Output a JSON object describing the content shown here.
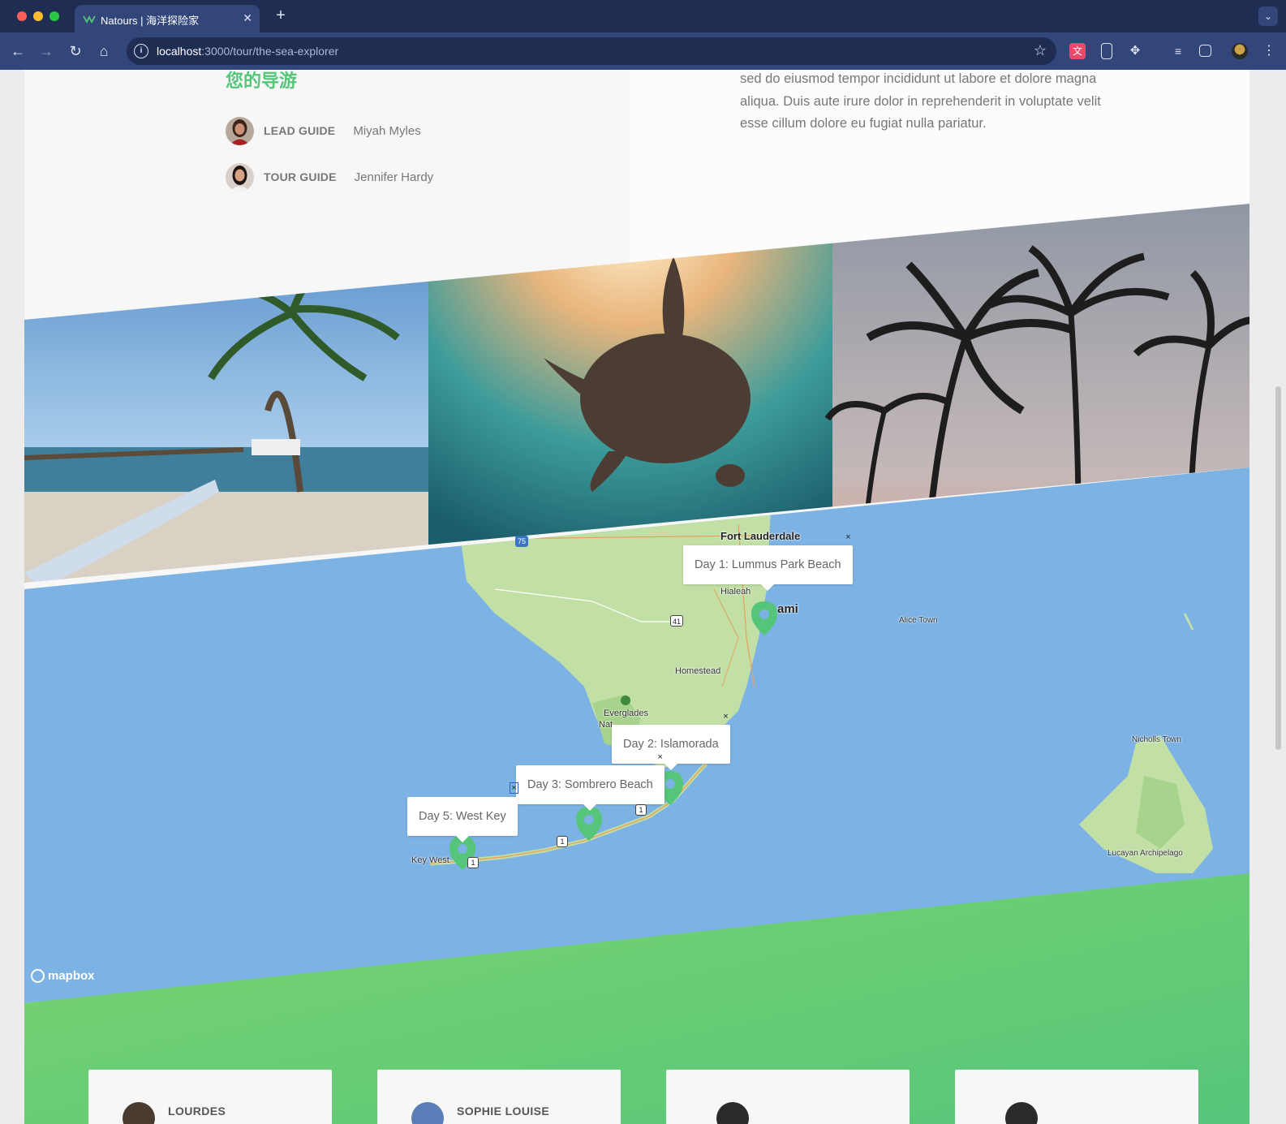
{
  "browser": {
    "tab_title": "Natours | 海洋探险家",
    "url_host": "localhost",
    "url_path": ":3000/tour/the-sea-explorer"
  },
  "guides": {
    "heading": "您的导游",
    "items": [
      {
        "role": "LEAD GUIDE",
        "name": "Miyah Myles"
      },
      {
        "role": "TOUR GUIDE",
        "name": "Jennifer Hardy"
      }
    ]
  },
  "description": {
    "text": "sed do eiusmod tempor incididunt ut labore et dolore magna aliqua. Duis aute irure dolor in reprehenderit in voluptate velit esse cillum dolore eu fugiat nulla pariatur."
  },
  "map": {
    "popups": [
      {
        "label": "Day 1: Lummus Park Beach"
      },
      {
        "label": "Day 2: Islamorada"
      },
      {
        "label": "Day 3: Sombrero Beach"
      },
      {
        "label": "Day 5: West Key"
      }
    ],
    "close_glyph": "×",
    "attribution": "mapbox",
    "places": {
      "fort_lauderdale": "Fort Lauderdale",
      "hialeah": "Hialeah",
      "miami": "ami",
      "homestead": "Homestead",
      "everglades": "Everglades",
      "everglades_np": "Nat",
      "alice_town": "Alice Town",
      "nicholls_town": "Nicholls Town",
      "lucayan": "Lucayan Archipelago",
      "key_west": "Key West",
      "hw75": "75",
      "hw41": "41",
      "hw1a": "1",
      "hw1b": "1",
      "hw1c": "1"
    }
  },
  "reviews": [
    {
      "name": "LOURDES"
    },
    {
      "name": "SOPHIE LOUISE"
    },
    {
      "name": ""
    },
    {
      "name": ""
    }
  ],
  "colors": {
    "brand_green": "#55c57a",
    "sea": "#7db3e4",
    "land": "#bfdfa8",
    "pin": "#55c57a",
    "browser_dark": "#1f2d52",
    "browser_bar": "#32467a"
  },
  "icons": {
    "back": "back-arrow-icon",
    "forward": "forward-arrow-icon",
    "reload": "reload-icon",
    "home": "home-icon",
    "star": "star-icon"
  }
}
